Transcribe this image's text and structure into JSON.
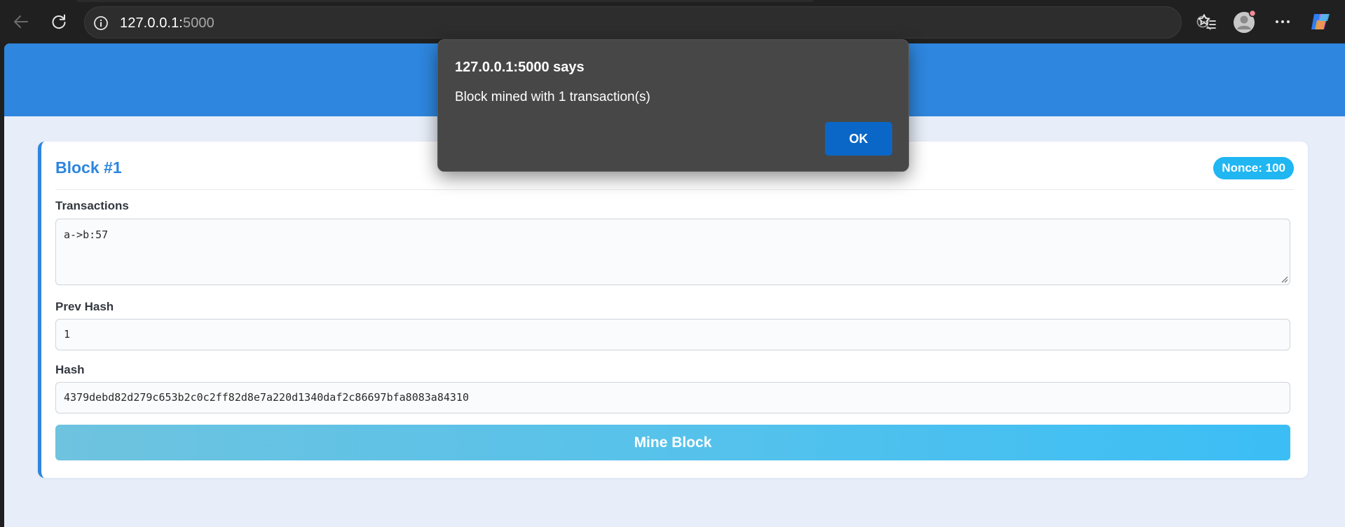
{
  "browser": {
    "url_host": "127.0.0.1:",
    "url_port": "5000",
    "icons": {
      "back": "back-arrow-icon",
      "reload": "reload-icon",
      "site_info": "info-icon",
      "zoom": "zoom-out-icon",
      "favorite": "star-icon",
      "favorites": "favorites-icon",
      "profile": "profile-icon",
      "more": "more-icon",
      "copilot": "copilot-icon"
    },
    "profile_notification_color": "#f28b95"
  },
  "block": {
    "title": "Block #1",
    "nonce_badge": "Nonce: 100",
    "transactions_label": "Transactions",
    "transactions_value": "a->b:57",
    "prev_hash_label": "Prev Hash",
    "prev_hash_value": "1",
    "hash_label": "Hash",
    "hash_value": "4379debd82d279c653b2c0c2ff82d8e7a220d1340daf2c86697bfa8083a84310",
    "mine_button_label": "Mine Block"
  },
  "alert": {
    "title": "127.0.0.1:5000 says",
    "message": "Block mined with 1 transaction(s)",
    "ok_label": "OK"
  },
  "colors": {
    "header": "#2e86de",
    "accent": "#2e86de",
    "badge": "#1fb6f2",
    "page_background": "#e8eef9",
    "ok_button": "#0a67c7"
  }
}
